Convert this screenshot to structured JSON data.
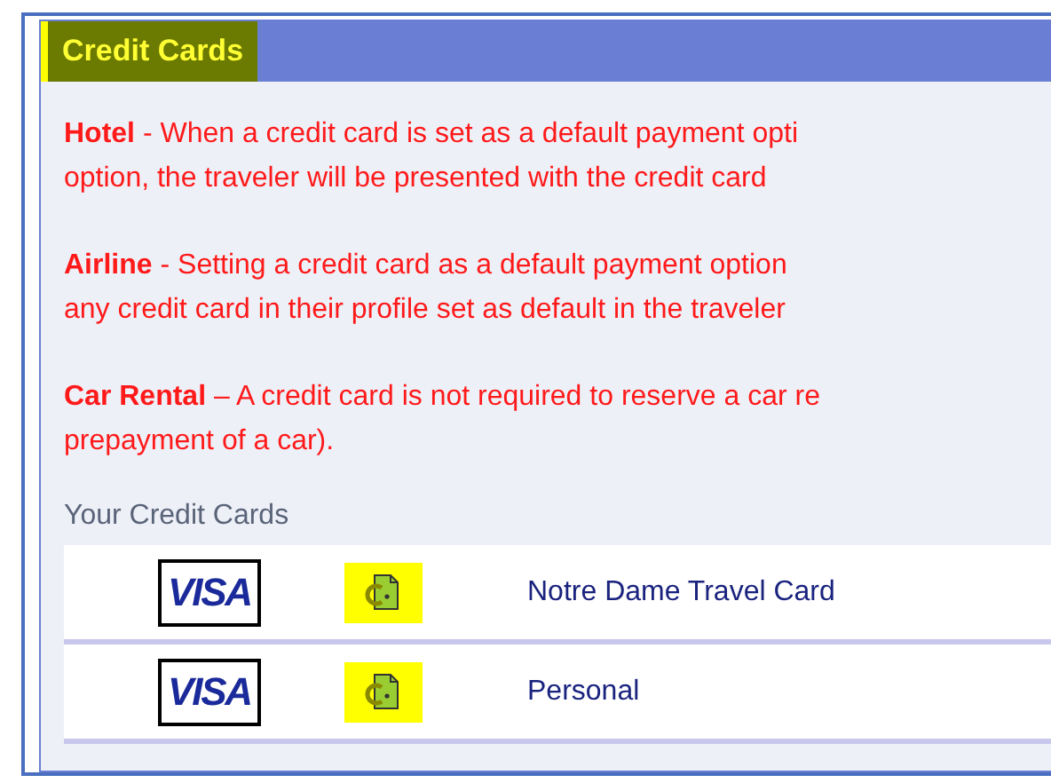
{
  "panel": {
    "title": "Credit Cards",
    "title_highlighted": true
  },
  "paragraphs": [
    {
      "lines": [
        "**Hotel** - When a credit card is set as a default payment opti",
        "option, the traveler will be presented with the credit card"
      ]
    },
    {
      "lines": [
        "**Airline** - Setting a credit card as a default payment option",
        "any credit card in their profile set as default in the traveler"
      ]
    },
    {
      "lines": [
        "**Car Rental** – A credit card is not required to reserve a car re",
        "prepayment of a car)."
      ]
    }
  ],
  "cards_heading": "Your Credit Cards",
  "cards": [
    {
      "logo_text": "VISA",
      "name": "Notre Dame Travel Card",
      "icon_highlighted": true
    },
    {
      "logo_text": "VISA",
      "name": "Personal",
      "icon_highlighted": true
    }
  ]
}
